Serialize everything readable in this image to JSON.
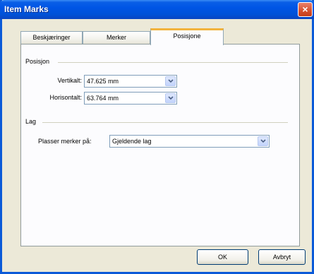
{
  "window": {
    "title": "Item Marks",
    "close_label": "×"
  },
  "tabs": [
    {
      "label": "Beskjæringer",
      "active": false
    },
    {
      "label": "Merker",
      "active": false
    },
    {
      "label": "Posisjone",
      "active": true
    }
  ],
  "position_group": {
    "title": "Posisjon",
    "vertical": {
      "label": "Vertikalt:",
      "value": "47.625 mm"
    },
    "horizontal": {
      "label": "Horisontalt:",
      "value": "63.764 mm"
    }
  },
  "layer_group": {
    "title": "Lag",
    "place_on": {
      "label": "Plasser merker på:",
      "value": "Gjeldende lag"
    }
  },
  "buttons": {
    "ok": "OK",
    "cancel": "Avbryt"
  },
  "icons": {
    "close": "close-icon",
    "dropdown": "chevron-down-icon"
  },
  "colors": {
    "titlebar": "#0055e5",
    "active_tab_accent": "#f2b33d",
    "dialog_bg": "#ece9d8"
  }
}
